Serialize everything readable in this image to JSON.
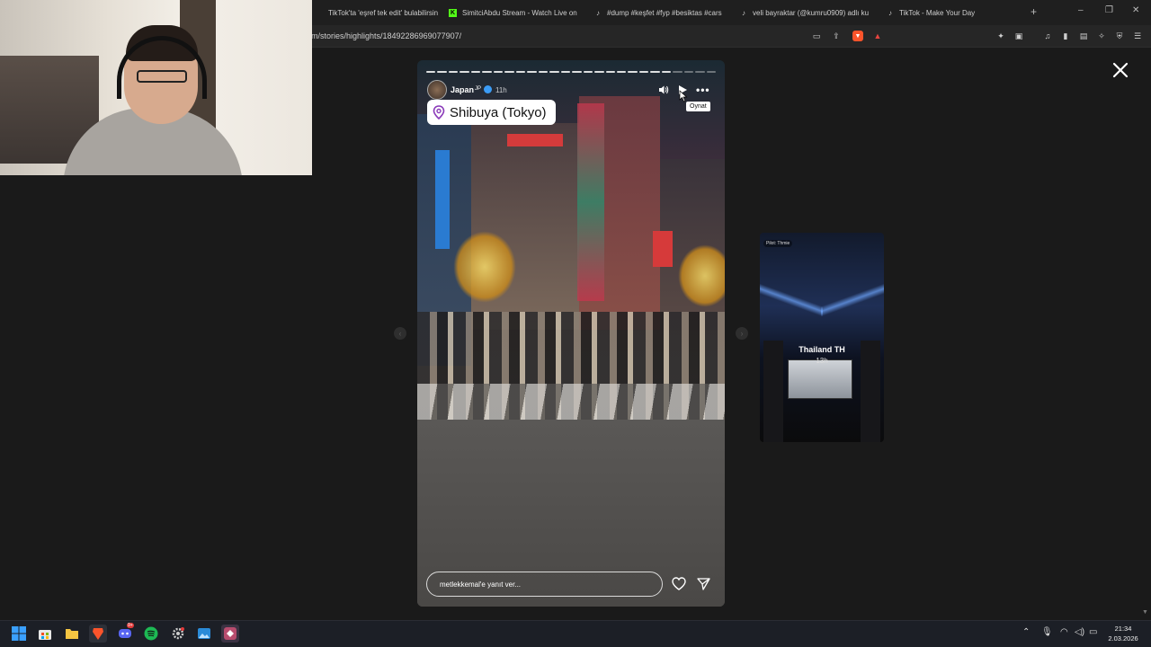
{
  "browser": {
    "tabs": [
      {
        "title": "TikTok'ta 'eşref tek edit' bulabilirsiniz",
        "icon": "tiktok-icon"
      },
      {
        "title": "SimitciAbdu Stream - Watch Live on",
        "icon": "kick-icon"
      },
      {
        "title": "#dump #keşfet #fyp #besiktas #cars",
        "icon": "tiktok-icon"
      },
      {
        "title": "veli bayraktar (@kumru0909) adlı ku",
        "icon": "tiktok-icon"
      },
      {
        "title": "TikTok - Make Your Day",
        "icon": "tiktok-icon"
      }
    ],
    "new_tab": "+",
    "url": "m/stories/highlights/18492286969077907/"
  },
  "story": {
    "username": "Japan",
    "flag": "JP",
    "time": "11h",
    "location": "Shibuya (Tokyo)",
    "tooltip": "Oynat",
    "reply_placeholder": "metlekkemal'e yanıt ver...",
    "progress_segments": 26,
    "active_segment": 21
  },
  "next_story": {
    "tag": "Pilot: Thmie",
    "name": "Thailand TH",
    "time": "13h"
  },
  "taskbar": {
    "discord_badge": "9+",
    "time": "21:34",
    "date": "2.03.2026"
  },
  "colors": {
    "kick_green": "#53fc18",
    "brave_orange": "#fb542b",
    "spotify_green": "#1db954",
    "discord_blurple": "#5865f2",
    "verified_blue": "#3b9cf5"
  }
}
